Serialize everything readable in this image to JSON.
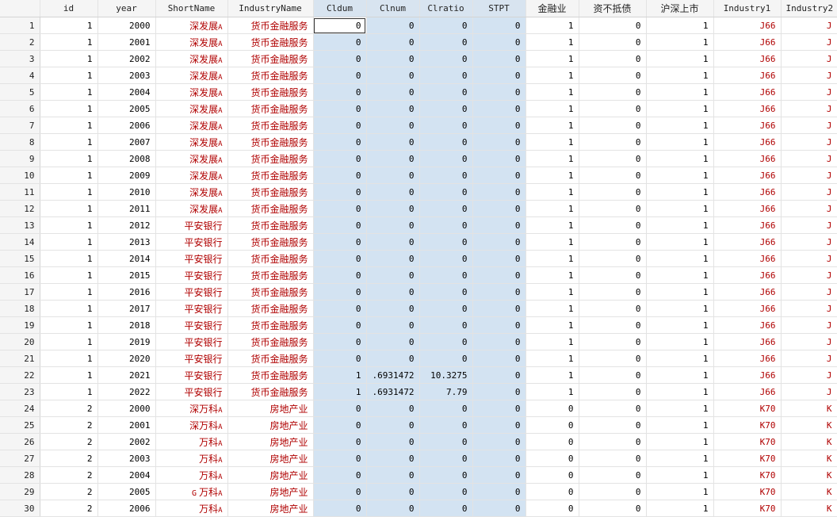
{
  "headers": [
    "id",
    "year",
    "ShortName",
    "IndustryName",
    "Cldum",
    "Clnum",
    "Clratio",
    "STPT",
    "金融业",
    "资不抵债",
    "沪深上市",
    "Industry1",
    "Industry2"
  ],
  "rows": [
    {
      "n": "1",
      "id": "1",
      "year": "2000",
      "short_name": "深发展",
      "short_sfx": "A",
      "short_pfx": "",
      "industry_name": "货币金融服务",
      "cldum": "0",
      "clnum": "0",
      "clratio": "0",
      "stpt": "0",
      "jr": "1",
      "zbdz": "0",
      "hs": "1",
      "ind1": "J66",
      "ind2": "J"
    },
    {
      "n": "2",
      "id": "1",
      "year": "2001",
      "short_name": "深发展",
      "short_sfx": "A",
      "short_pfx": "",
      "industry_name": "货币金融服务",
      "cldum": "0",
      "clnum": "0",
      "clratio": "0",
      "stpt": "0",
      "jr": "1",
      "zbdz": "0",
      "hs": "1",
      "ind1": "J66",
      "ind2": "J"
    },
    {
      "n": "3",
      "id": "1",
      "year": "2002",
      "short_name": "深发展",
      "short_sfx": "A",
      "short_pfx": "",
      "industry_name": "货币金融服务",
      "cldum": "0",
      "clnum": "0",
      "clratio": "0",
      "stpt": "0",
      "jr": "1",
      "zbdz": "0",
      "hs": "1",
      "ind1": "J66",
      "ind2": "J"
    },
    {
      "n": "4",
      "id": "1",
      "year": "2003",
      "short_name": "深发展",
      "short_sfx": "A",
      "short_pfx": "",
      "industry_name": "货币金融服务",
      "cldum": "0",
      "clnum": "0",
      "clratio": "0",
      "stpt": "0",
      "jr": "1",
      "zbdz": "0",
      "hs": "1",
      "ind1": "J66",
      "ind2": "J"
    },
    {
      "n": "5",
      "id": "1",
      "year": "2004",
      "short_name": "深发展",
      "short_sfx": "A",
      "short_pfx": "",
      "industry_name": "货币金融服务",
      "cldum": "0",
      "clnum": "0",
      "clratio": "0",
      "stpt": "0",
      "jr": "1",
      "zbdz": "0",
      "hs": "1",
      "ind1": "J66",
      "ind2": "J"
    },
    {
      "n": "6",
      "id": "1",
      "year": "2005",
      "short_name": "深发展",
      "short_sfx": "A",
      "short_pfx": "",
      "industry_name": "货币金融服务",
      "cldum": "0",
      "clnum": "0",
      "clratio": "0",
      "stpt": "0",
      "jr": "1",
      "zbdz": "0",
      "hs": "1",
      "ind1": "J66",
      "ind2": "J"
    },
    {
      "n": "7",
      "id": "1",
      "year": "2006",
      "short_name": "深发展",
      "short_sfx": "A",
      "short_pfx": "",
      "industry_name": "货币金融服务",
      "cldum": "0",
      "clnum": "0",
      "clratio": "0",
      "stpt": "0",
      "jr": "1",
      "zbdz": "0",
      "hs": "1",
      "ind1": "J66",
      "ind2": "J"
    },
    {
      "n": "8",
      "id": "1",
      "year": "2007",
      "short_name": "深发展",
      "short_sfx": "A",
      "short_pfx": "",
      "industry_name": "货币金融服务",
      "cldum": "0",
      "clnum": "0",
      "clratio": "0",
      "stpt": "0",
      "jr": "1",
      "zbdz": "0",
      "hs": "1",
      "ind1": "J66",
      "ind2": "J"
    },
    {
      "n": "9",
      "id": "1",
      "year": "2008",
      "short_name": "深发展",
      "short_sfx": "A",
      "short_pfx": "",
      "industry_name": "货币金融服务",
      "cldum": "0",
      "clnum": "0",
      "clratio": "0",
      "stpt": "0",
      "jr": "1",
      "zbdz": "0",
      "hs": "1",
      "ind1": "J66",
      "ind2": "J"
    },
    {
      "n": "10",
      "id": "1",
      "year": "2009",
      "short_name": "深发展",
      "short_sfx": "A",
      "short_pfx": "",
      "industry_name": "货币金融服务",
      "cldum": "0",
      "clnum": "0",
      "clratio": "0",
      "stpt": "0",
      "jr": "1",
      "zbdz": "0",
      "hs": "1",
      "ind1": "J66",
      "ind2": "J"
    },
    {
      "n": "11",
      "id": "1",
      "year": "2010",
      "short_name": "深发展",
      "short_sfx": "A",
      "short_pfx": "",
      "industry_name": "货币金融服务",
      "cldum": "0",
      "clnum": "0",
      "clratio": "0",
      "stpt": "0",
      "jr": "1",
      "zbdz": "0",
      "hs": "1",
      "ind1": "J66",
      "ind2": "J"
    },
    {
      "n": "12",
      "id": "1",
      "year": "2011",
      "short_name": "深发展",
      "short_sfx": "A",
      "short_pfx": "",
      "industry_name": "货币金融服务",
      "cldum": "0",
      "clnum": "0",
      "clratio": "0",
      "stpt": "0",
      "jr": "1",
      "zbdz": "0",
      "hs": "1",
      "ind1": "J66",
      "ind2": "J"
    },
    {
      "n": "13",
      "id": "1",
      "year": "2012",
      "short_name": "平安银行",
      "short_sfx": "",
      "short_pfx": "",
      "industry_name": "货币金融服务",
      "cldum": "0",
      "clnum": "0",
      "clratio": "0",
      "stpt": "0",
      "jr": "1",
      "zbdz": "0",
      "hs": "1",
      "ind1": "J66",
      "ind2": "J"
    },
    {
      "n": "14",
      "id": "1",
      "year": "2013",
      "short_name": "平安银行",
      "short_sfx": "",
      "short_pfx": "",
      "industry_name": "货币金融服务",
      "cldum": "0",
      "clnum": "0",
      "clratio": "0",
      "stpt": "0",
      "jr": "1",
      "zbdz": "0",
      "hs": "1",
      "ind1": "J66",
      "ind2": "J"
    },
    {
      "n": "15",
      "id": "1",
      "year": "2014",
      "short_name": "平安银行",
      "short_sfx": "",
      "short_pfx": "",
      "industry_name": "货币金融服务",
      "cldum": "0",
      "clnum": "0",
      "clratio": "0",
      "stpt": "0",
      "jr": "1",
      "zbdz": "0",
      "hs": "1",
      "ind1": "J66",
      "ind2": "J"
    },
    {
      "n": "16",
      "id": "1",
      "year": "2015",
      "short_name": "平安银行",
      "short_sfx": "",
      "short_pfx": "",
      "industry_name": "货币金融服务",
      "cldum": "0",
      "clnum": "0",
      "clratio": "0",
      "stpt": "0",
      "jr": "1",
      "zbdz": "0",
      "hs": "1",
      "ind1": "J66",
      "ind2": "J"
    },
    {
      "n": "17",
      "id": "1",
      "year": "2016",
      "short_name": "平安银行",
      "short_sfx": "",
      "short_pfx": "",
      "industry_name": "货币金融服务",
      "cldum": "0",
      "clnum": "0",
      "clratio": "0",
      "stpt": "0",
      "jr": "1",
      "zbdz": "0",
      "hs": "1",
      "ind1": "J66",
      "ind2": "J"
    },
    {
      "n": "18",
      "id": "1",
      "year": "2017",
      "short_name": "平安银行",
      "short_sfx": "",
      "short_pfx": "",
      "industry_name": "货币金融服务",
      "cldum": "0",
      "clnum": "0",
      "clratio": "0",
      "stpt": "0",
      "jr": "1",
      "zbdz": "0",
      "hs": "1",
      "ind1": "J66",
      "ind2": "J"
    },
    {
      "n": "19",
      "id": "1",
      "year": "2018",
      "short_name": "平安银行",
      "short_sfx": "",
      "short_pfx": "",
      "industry_name": "货币金融服务",
      "cldum": "0",
      "clnum": "0",
      "clratio": "0",
      "stpt": "0",
      "jr": "1",
      "zbdz": "0",
      "hs": "1",
      "ind1": "J66",
      "ind2": "J"
    },
    {
      "n": "20",
      "id": "1",
      "year": "2019",
      "short_name": "平安银行",
      "short_sfx": "",
      "short_pfx": "",
      "industry_name": "货币金融服务",
      "cldum": "0",
      "clnum": "0",
      "clratio": "0",
      "stpt": "0",
      "jr": "1",
      "zbdz": "0",
      "hs": "1",
      "ind1": "J66",
      "ind2": "J"
    },
    {
      "n": "21",
      "id": "1",
      "year": "2020",
      "short_name": "平安银行",
      "short_sfx": "",
      "short_pfx": "",
      "industry_name": "货币金融服务",
      "cldum": "0",
      "clnum": "0",
      "clratio": "0",
      "stpt": "0",
      "jr": "1",
      "zbdz": "0",
      "hs": "1",
      "ind1": "J66",
      "ind2": "J"
    },
    {
      "n": "22",
      "id": "1",
      "year": "2021",
      "short_name": "平安银行",
      "short_sfx": "",
      "short_pfx": "",
      "industry_name": "货币金融服务",
      "cldum": "1",
      "clnum": ".6931472",
      "clratio": "10.3275",
      "stpt": "0",
      "jr": "1",
      "zbdz": "0",
      "hs": "1",
      "ind1": "J66",
      "ind2": "J"
    },
    {
      "n": "23",
      "id": "1",
      "year": "2022",
      "short_name": "平安银行",
      "short_sfx": "",
      "short_pfx": "",
      "industry_name": "货币金融服务",
      "cldum": "1",
      "clnum": ".6931472",
      "clratio": "7.79",
      "stpt": "0",
      "jr": "1",
      "zbdz": "0",
      "hs": "1",
      "ind1": "J66",
      "ind2": "J"
    },
    {
      "n": "24",
      "id": "2",
      "year": "2000",
      "short_name": "深万科",
      "short_sfx": "A",
      "short_pfx": "",
      "industry_name": "房地产业",
      "cldum": "0",
      "clnum": "0",
      "clratio": "0",
      "stpt": "0",
      "jr": "0",
      "zbdz": "0",
      "hs": "1",
      "ind1": "K70",
      "ind2": "K"
    },
    {
      "n": "25",
      "id": "2",
      "year": "2001",
      "short_name": "深万科",
      "short_sfx": "A",
      "short_pfx": "",
      "industry_name": "房地产业",
      "cldum": "0",
      "clnum": "0",
      "clratio": "0",
      "stpt": "0",
      "jr": "0",
      "zbdz": "0",
      "hs": "1",
      "ind1": "K70",
      "ind2": "K"
    },
    {
      "n": "26",
      "id": "2",
      "year": "2002",
      "short_name": "万科",
      "short_sfx": "A",
      "short_pfx": "",
      "industry_name": "房地产业",
      "cldum": "0",
      "clnum": "0",
      "clratio": "0",
      "stpt": "0",
      "jr": "0",
      "zbdz": "0",
      "hs": "1",
      "ind1": "K70",
      "ind2": "K"
    },
    {
      "n": "27",
      "id": "2",
      "year": "2003",
      "short_name": "万科",
      "short_sfx": "A",
      "short_pfx": "",
      "industry_name": "房地产业",
      "cldum": "0",
      "clnum": "0",
      "clratio": "0",
      "stpt": "0",
      "jr": "0",
      "zbdz": "0",
      "hs": "1",
      "ind1": "K70",
      "ind2": "K"
    },
    {
      "n": "28",
      "id": "2",
      "year": "2004",
      "short_name": "万科",
      "short_sfx": "A",
      "short_pfx": "",
      "industry_name": "房地产业",
      "cldum": "0",
      "clnum": "0",
      "clratio": "0",
      "stpt": "0",
      "jr": "0",
      "zbdz": "0",
      "hs": "1",
      "ind1": "K70",
      "ind2": "K"
    },
    {
      "n": "29",
      "id": "2",
      "year": "2005",
      "short_name": "万科",
      "short_sfx": "A",
      "short_pfx": "G",
      "industry_name": "房地产业",
      "cldum": "0",
      "clnum": "0",
      "clratio": "0",
      "stpt": "0",
      "jr": "0",
      "zbdz": "0",
      "hs": "1",
      "ind1": "K70",
      "ind2": "K"
    },
    {
      "n": "30",
      "id": "2",
      "year": "2006",
      "short_name": "万科",
      "short_sfx": "A",
      "short_pfx": "",
      "industry_name": "房地产业",
      "cldum": "0",
      "clnum": "0",
      "clratio": "0",
      "stpt": "0",
      "jr": "0",
      "zbdz": "0",
      "hs": "1",
      "ind1": "K70",
      "ind2": "K"
    }
  ],
  "colors": {
    "string_text": "#b00000",
    "selection": "#d3e3f2",
    "header_bg": "#f5f5f5"
  }
}
